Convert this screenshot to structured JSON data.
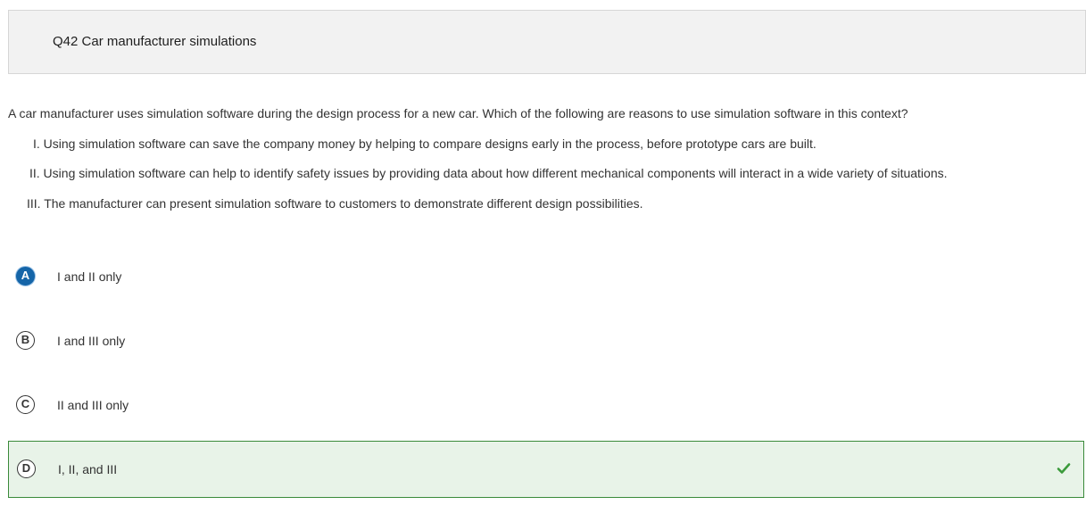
{
  "question": {
    "title": "Q42 Car manufacturer simulations",
    "prompt": "A car manufacturer uses simulation software during the design process for a new car. Which of the following are reasons to use simulation software in this context?",
    "statements": [
      "I. Using simulation software can save the company money by helping to compare designs early in the process, before prototype cars are built.",
      "II. Using simulation software can help to identify safety issues by providing data about how different mechanical components will interact in a wide variety of situations.",
      "III. The manufacturer can present simulation software to customers to demonstrate different design possibilities."
    ]
  },
  "options": [
    {
      "letter": "A",
      "text": "I and II only",
      "selected": true,
      "correct": false
    },
    {
      "letter": "B",
      "text": "I and III only",
      "selected": false,
      "correct": false
    },
    {
      "letter": "C",
      "text": "II and III only",
      "selected": false,
      "correct": false
    },
    {
      "letter": "D",
      "text": "I, II, and III",
      "selected": false,
      "correct": true
    }
  ],
  "colors": {
    "selected_badge": "#1565a8",
    "correct_background": "#e8f3e8",
    "correct_border": "#3a8a3a",
    "check": "#3a9a3a"
  },
  "icons": {
    "correct_indicator": "check-icon"
  }
}
